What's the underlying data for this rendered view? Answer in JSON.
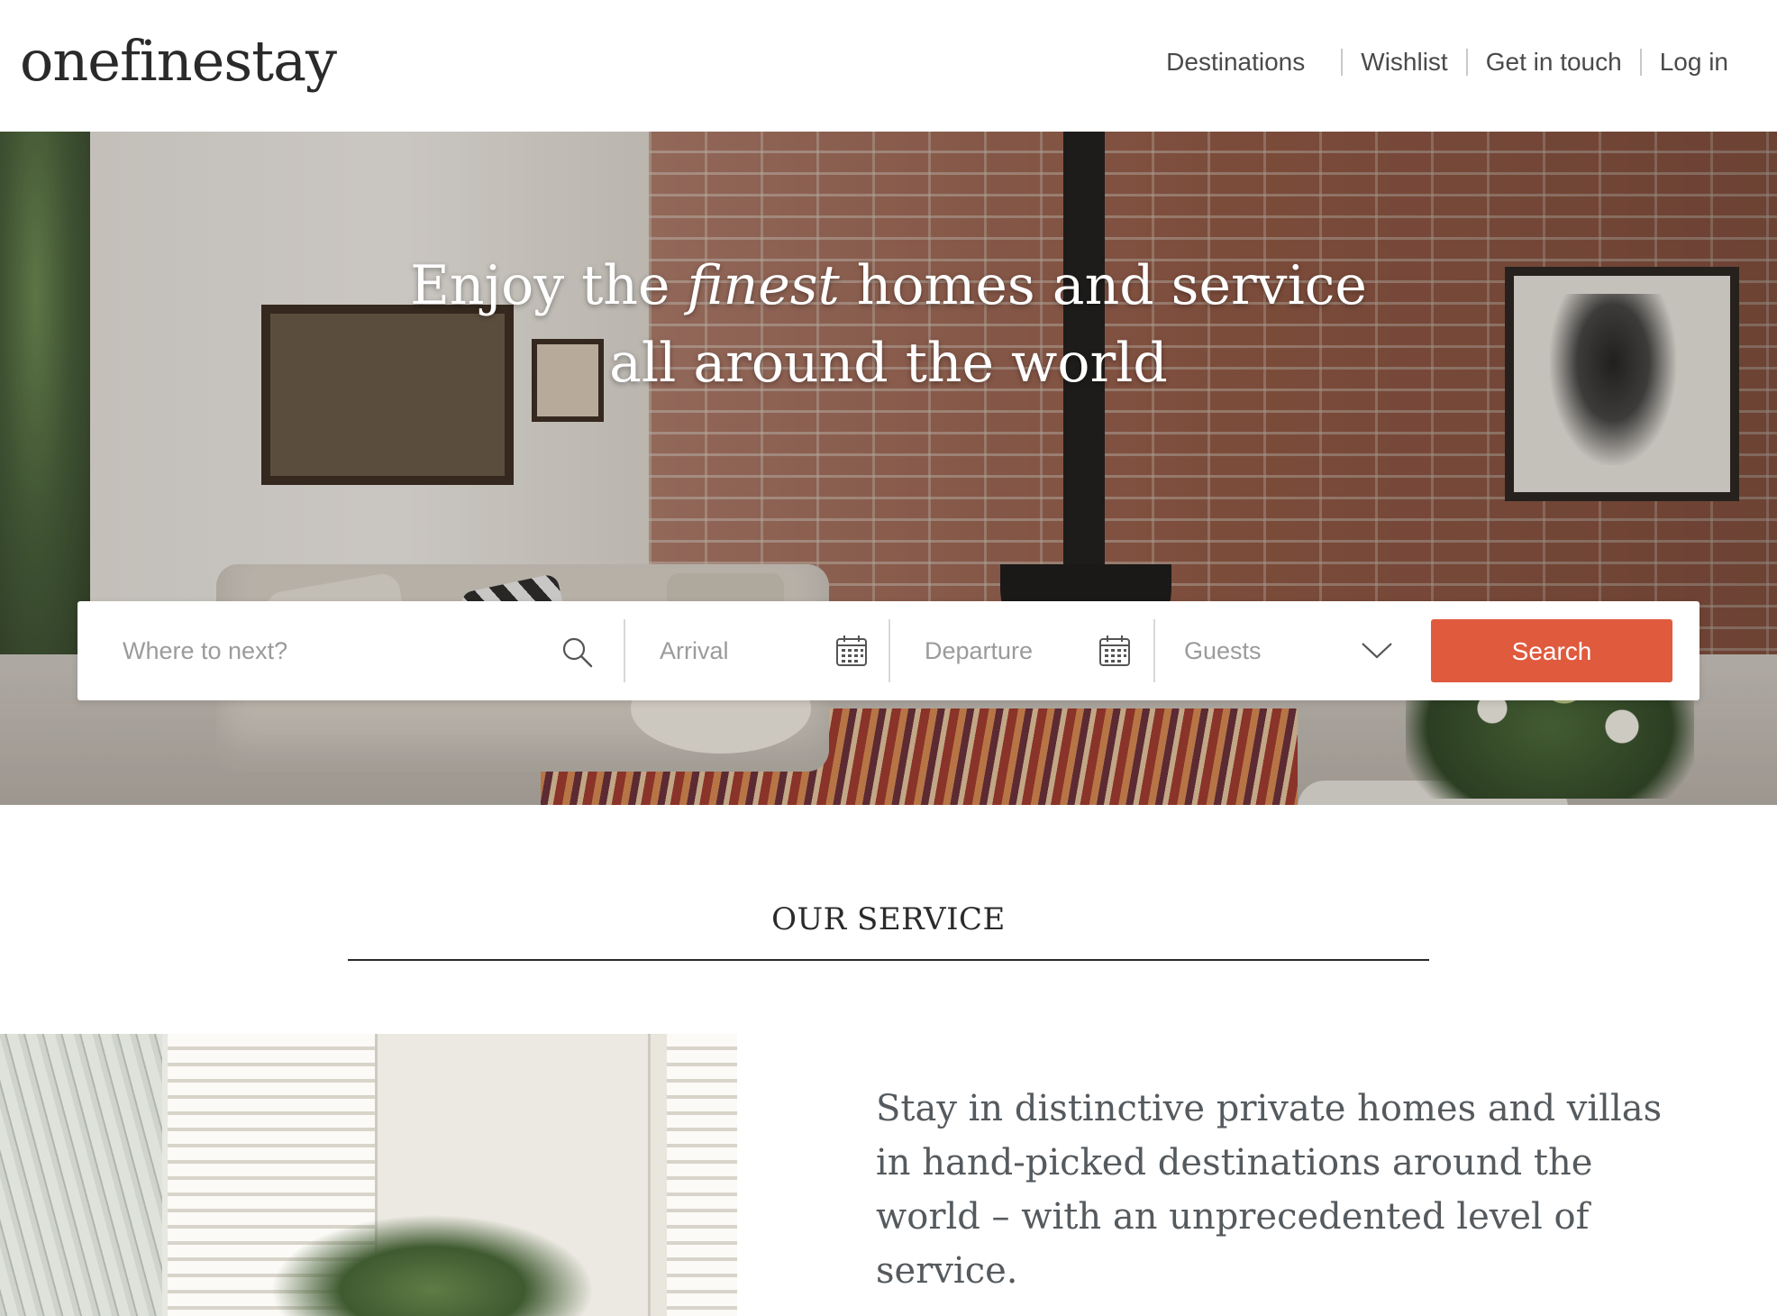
{
  "brand": {
    "logo": "onefinestay"
  },
  "nav": {
    "items": [
      {
        "label": "Destinations"
      },
      {
        "label": "Wishlist"
      },
      {
        "label": "Get in touch"
      },
      {
        "label": "Log in"
      }
    ]
  },
  "hero": {
    "headline_line1_before": "Enjoy the ",
    "headline_line1_emphasis": "finest",
    "headline_line1_after": " homes and service",
    "headline_line2": "all around the world"
  },
  "search": {
    "destination_placeholder": "Where to next?",
    "arrival_placeholder": "Arrival",
    "departure_placeholder": "Departure",
    "guests_placeholder": "Guests",
    "search_label": "Search",
    "icons": [
      "search-icon",
      "calendar-icon",
      "calendar-icon",
      "chevron-down-icon"
    ],
    "accent_color": "#e05a3e"
  },
  "service": {
    "title": "OUR SERVICE",
    "description": "Stay in distinctive private homes and villas in hand-picked destinations around the world – with an unprecedented level of service."
  }
}
